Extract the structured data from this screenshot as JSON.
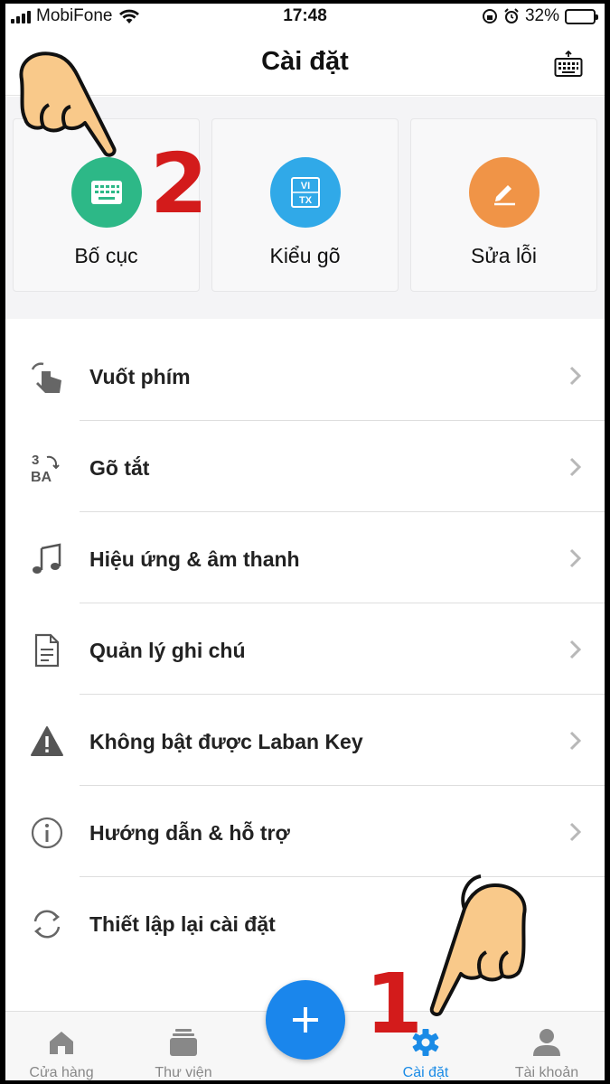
{
  "status_bar": {
    "carrier": "MobiFone",
    "time": "17:48",
    "battery_percent": "32%",
    "battery_level": 0.32
  },
  "header": {
    "title": "Cài đặt",
    "keyboard_icon": "keyboard-icon"
  },
  "cards": [
    {
      "label": "Bố cục",
      "icon": "keyboard-icon",
      "color": "#2db887"
    },
    {
      "label": "Kiểu gõ",
      "icon": "vitx-icon",
      "color": "#30a9e8",
      "icon_text_top": "VI",
      "icon_text_bottom": "TX"
    },
    {
      "label": "Sửa lỗi",
      "icon": "pencil-icon",
      "color": "#f09447"
    }
  ],
  "settings": [
    {
      "label": "Vuốt phím",
      "icon": "swipe-hand-icon"
    },
    {
      "label": "Gõ tắt",
      "icon": "shortcut-icon",
      "icon_text_top": "3",
      "icon_text_bottom": "BA"
    },
    {
      "label": "Hiệu ứng & âm thanh",
      "icon": "music-note-icon"
    },
    {
      "label": "Quản lý ghi chú",
      "icon": "document-icon"
    },
    {
      "label": "Không bật được Laban Key",
      "icon": "warning-icon"
    },
    {
      "label": "Hướng dẫn & hỗ trợ",
      "icon": "info-icon"
    },
    {
      "label": "Thiết lập lại cài đặt",
      "icon": "reset-icon"
    }
  ],
  "tabs": [
    {
      "label": "Cửa hàng",
      "icon": "store-icon"
    },
    {
      "label": "Thư viện",
      "icon": "library-icon"
    },
    {
      "label": "Cài đặt",
      "icon": "gear-icon",
      "active": true
    },
    {
      "label": "Tài khoản",
      "icon": "account-icon"
    }
  ],
  "fab": {
    "icon": "plus-icon"
  },
  "annotations": {
    "step_1": "1",
    "step_2": "2",
    "color": "#d31b1b"
  },
  "colors": {
    "accent": "#1a8be6",
    "fab": "#1a86ec"
  }
}
